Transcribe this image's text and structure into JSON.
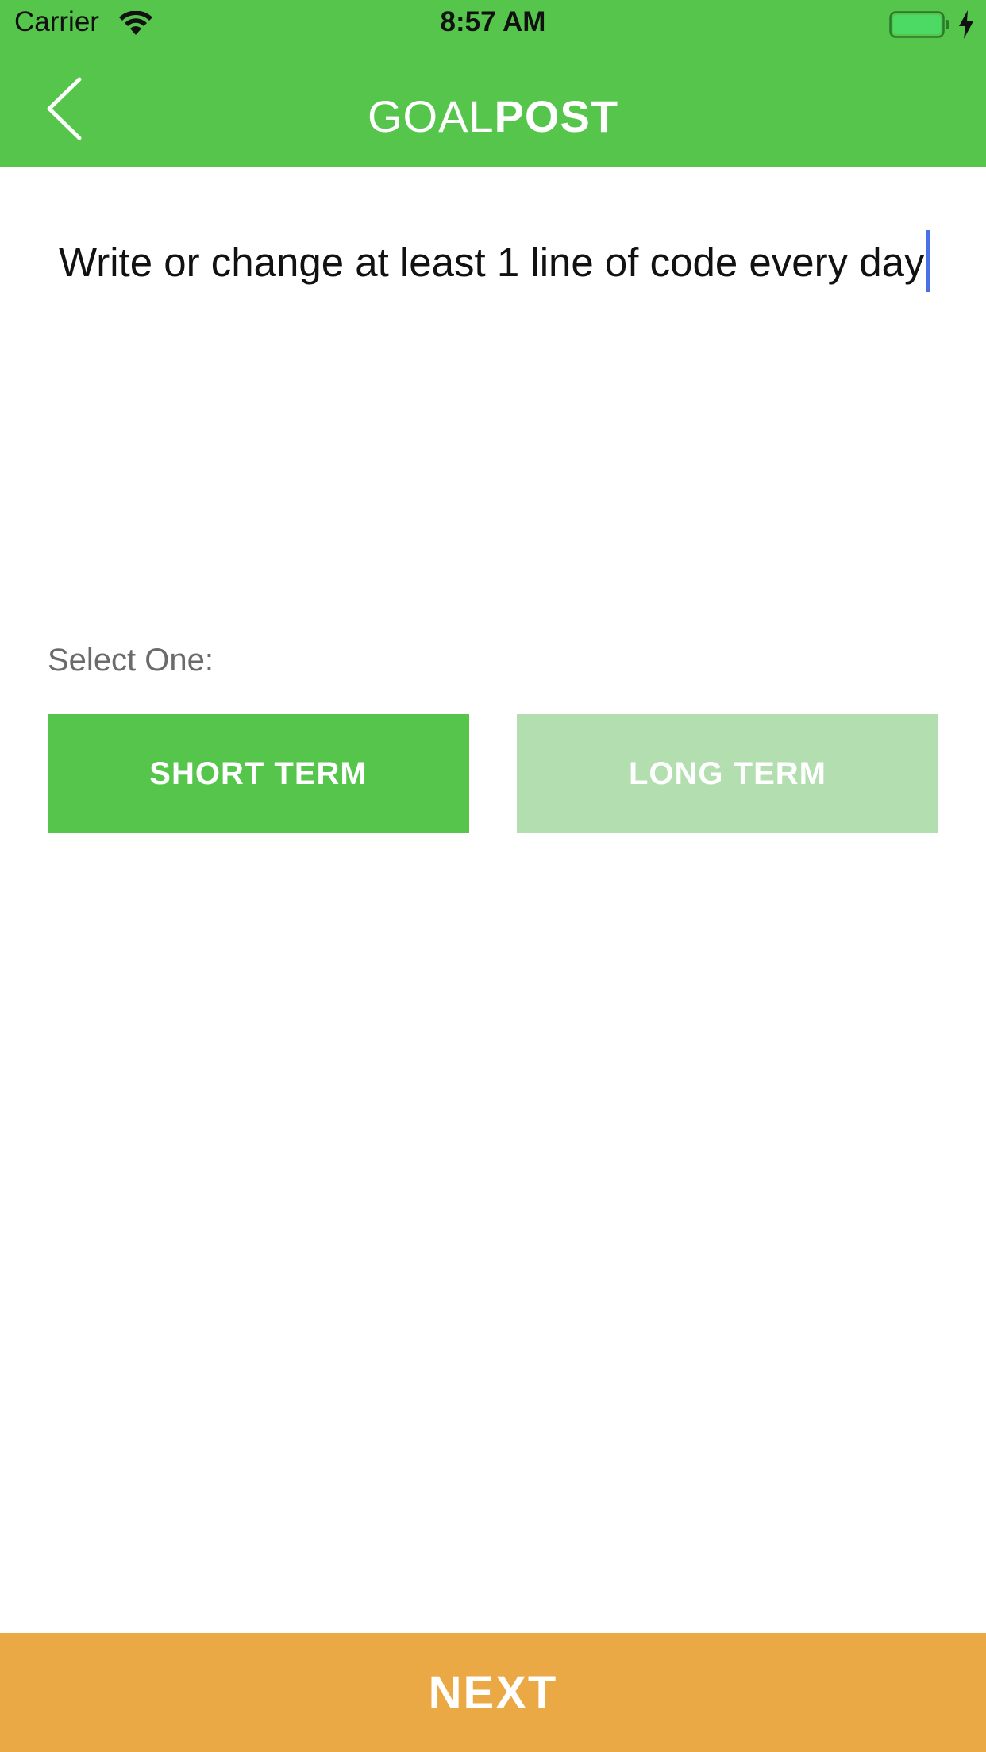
{
  "status_bar": {
    "carrier": "Carrier",
    "time": "8:57 AM",
    "icons": [
      "wifi-icon",
      "battery-icon",
      "charging-icon"
    ]
  },
  "nav": {
    "back_icon": "chevron-left-icon",
    "title_thin": "GOAL",
    "title_bold": "POST"
  },
  "goal": {
    "text": "Write or change at least 1 line of code every day"
  },
  "selection": {
    "label": "Select One:",
    "options": [
      {
        "label": "SHORT TERM",
        "selected": true
      },
      {
        "label": "LONG TERM",
        "selected": false
      }
    ]
  },
  "footer": {
    "next_label": "NEXT"
  },
  "colors": {
    "brand_green": "#55c64b",
    "light_green": "#b3dfb0",
    "next_orange": "#eba945",
    "caret_blue": "#4a6fe8"
  }
}
